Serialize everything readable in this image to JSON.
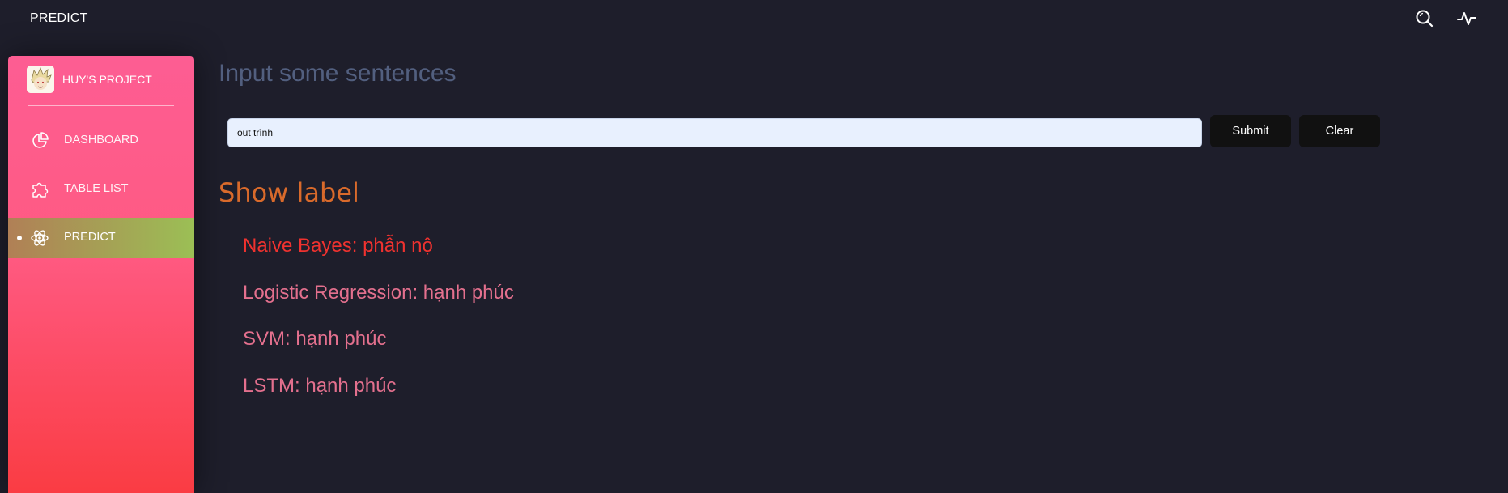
{
  "topbar": {
    "brand": "PREDICT",
    "icons": [
      "search-icon",
      "activity-pulse-icon"
    ]
  },
  "sidebar": {
    "logo_text": "HUY'S PROJECT",
    "items": [
      {
        "label": "DASHBOARD",
        "icon": "pie-chart-icon",
        "active": false
      },
      {
        "label": "TABLE LIST",
        "icon": "puzzle-icon",
        "active": false
      },
      {
        "label": "PREDICT",
        "icon": "atom-icon",
        "active": true
      }
    ]
  },
  "main": {
    "input_title": "Input some sentences",
    "input_value": "out trình",
    "submit_label": "Submit",
    "clear_label": "Clear",
    "label_title": "Show label",
    "results": [
      {
        "text": "Naive Bayes: phẫn nộ"
      },
      {
        "text": "Logistic Regression: hạnh phúc"
      },
      {
        "text": "SVM: hạnh phúc"
      },
      {
        "text": "LSTM: hạnh phúc"
      }
    ]
  },
  "colors": {
    "background": "#1e1e2b",
    "sidebar_top": "#fd5d93",
    "sidebar_bottom": "#fa3c43",
    "active_item": "#9bbf55",
    "title_muted": "#525f7f",
    "label_title": "#d96a2b",
    "result_primary": "#f0322f",
    "result_secondary": "#e4708e"
  }
}
